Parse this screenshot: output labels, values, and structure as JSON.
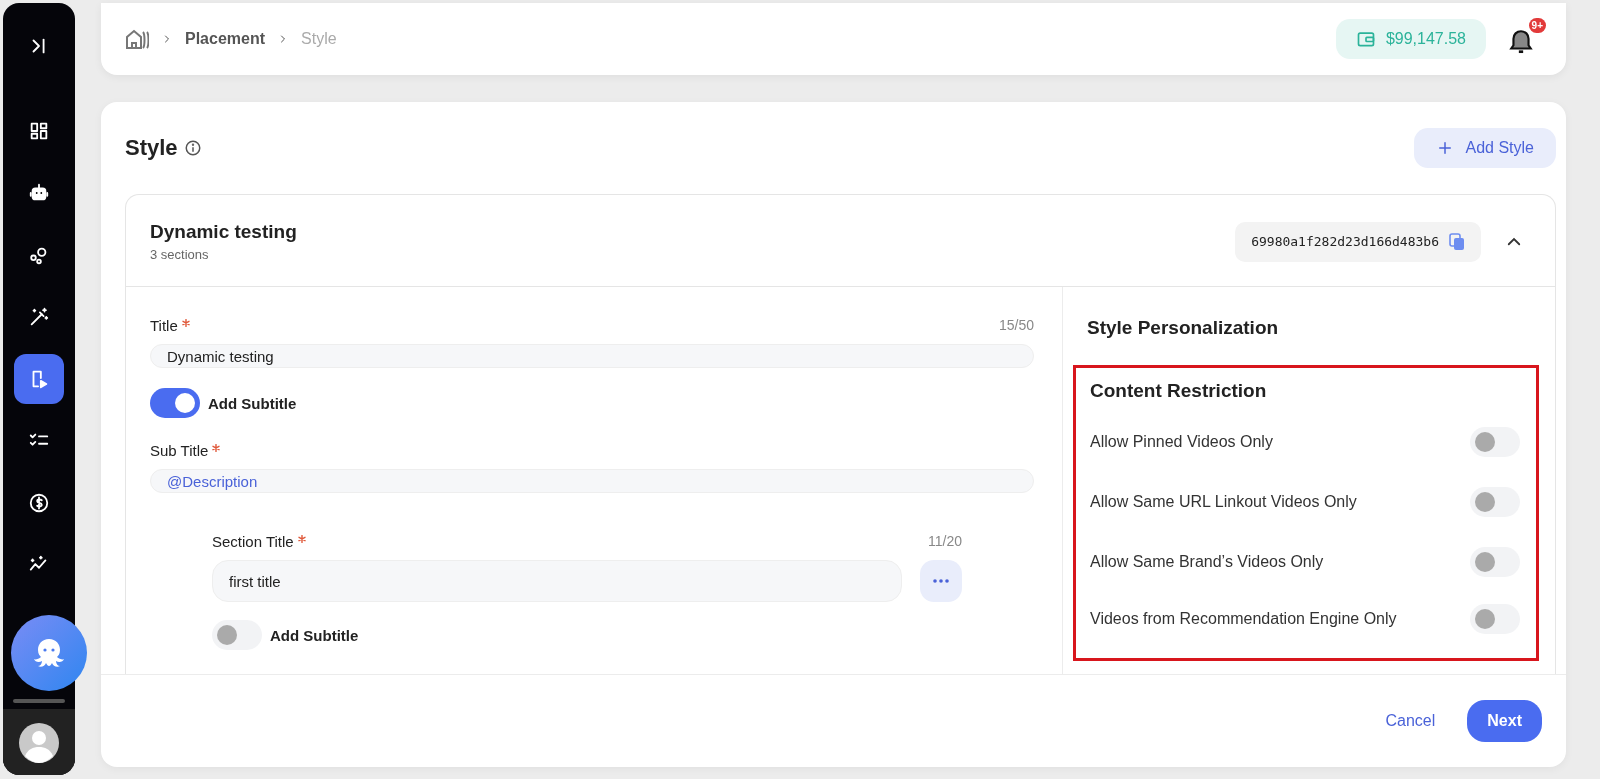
{
  "sidebar": {
    "items": [
      {
        "selected": false
      },
      {
        "selected": false
      },
      {
        "selected": false
      },
      {
        "selected": false
      },
      {
        "selected": false
      },
      {
        "selected": true
      },
      {
        "selected": false
      },
      {
        "selected": false
      },
      {
        "selected": false
      }
    ]
  },
  "breadcrumbs": [
    {
      "label": "Placement",
      "current": false
    },
    {
      "label": "Style",
      "current": true
    }
  ],
  "balance": "$99,147.58",
  "notifications": {
    "badge": "9+"
  },
  "page": {
    "title": "Style",
    "add_button": "Add Style"
  },
  "style_card": {
    "title": "Dynamic testing",
    "subtitle": "3 sections",
    "id": "69980a1f282d23d166d483b6",
    "expanded": true
  },
  "form": {
    "title_field": {
      "label": "Title",
      "required": true,
      "counter": "15/50",
      "value": "Dynamic testing"
    },
    "subtitle_toggle": {
      "label": "Add Subtitle",
      "on": true
    },
    "subtitle_field": {
      "label": "Sub Title",
      "required": true,
      "value": "@Description"
    },
    "section": {
      "label": "Section Title",
      "required": true,
      "counter": "11/20",
      "value": "first title",
      "subtitle_toggle": {
        "label": "Add Subtitle",
        "on": false
      }
    }
  },
  "personalization": {
    "title": "Style Personalization",
    "restriction": {
      "title": "Content Restriction",
      "highlighted": true,
      "options": [
        {
          "label": "Allow Pinned Videos Only",
          "on": false
        },
        {
          "label": "Allow Same URL Linkout Videos Only",
          "on": false
        },
        {
          "label": "Allow Same Brand’s Videos Only",
          "on": false
        },
        {
          "label": "Videos from Recommendation Engine Only",
          "on": false
        }
      ]
    }
  },
  "footer": {
    "cancel": "Cancel",
    "next": "Next"
  }
}
